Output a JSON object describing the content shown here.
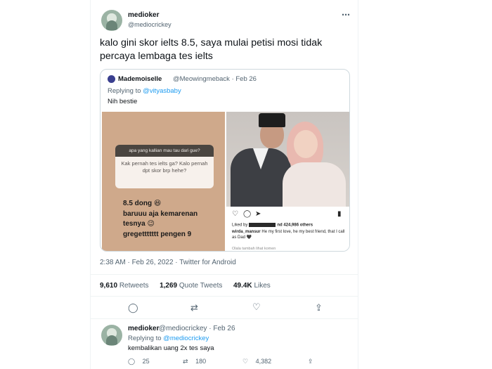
{
  "main_tweet": {
    "display_name": "medioker",
    "handle": "@mediocrickey",
    "text": "kalo gini skor ielts 8.5, saya mulai petisi mosi tidak percaya lembaga tes ielts",
    "timestamp": "2:38 AM · Feb 26, 2022 · Twitter for Android",
    "stats": {
      "retweets_count": "9,610",
      "retweets_label": "Retweets",
      "quotes_count": "1,269",
      "quotes_label": "Quote Tweets",
      "likes_count": "49.4K",
      "likes_label": "Likes"
    }
  },
  "quoted_tweet": {
    "display_name": "Mademoiselle",
    "handle_date": "@Meowingmeback · Feb 26",
    "replying_prefix": "Replying to",
    "replying_to": "@vityasbaby",
    "text": "Nih bestie",
    "left_image": {
      "question_header": "apa yang kallian mau tau dari gue?",
      "question": "Kak pernah tes ielts ga? Kalo pernah dpt skor brp hehe?",
      "answer_lines": [
        "8.5 dong 😆",
        "baruuu aja kemarenan",
        "tesnya 😉",
        "gregettttttt pengen 9"
      ]
    },
    "right_image": {
      "likes_prefix": "Liked by",
      "likes_suffix": "nd 424,986 others",
      "caption_user": "wirda_mansur",
      "caption_text": "He my first love, he my best friend, that I call as Dad 🖤",
      "more": "Olala tambah lihat komen"
    }
  },
  "reply_tweet": {
    "display_name": "medioker",
    "handle_date": "@mediocrickey · Feb 26",
    "replying_prefix": "Replying to",
    "replying_to": "@mediocrickey",
    "text": "kembalikan uang 2x tes saya",
    "reply_count": "25",
    "retweet_count": "180",
    "like_count": "4,382"
  },
  "icons": {
    "more": "⋯",
    "reply": "◯",
    "retweet": "⇄",
    "like": "♡",
    "share": "⇪"
  },
  "colors": {
    "accent": "#1d9bf0",
    "text_primary": "#0f1419",
    "text_secondary": "#536471",
    "border": "#cfd9de"
  }
}
